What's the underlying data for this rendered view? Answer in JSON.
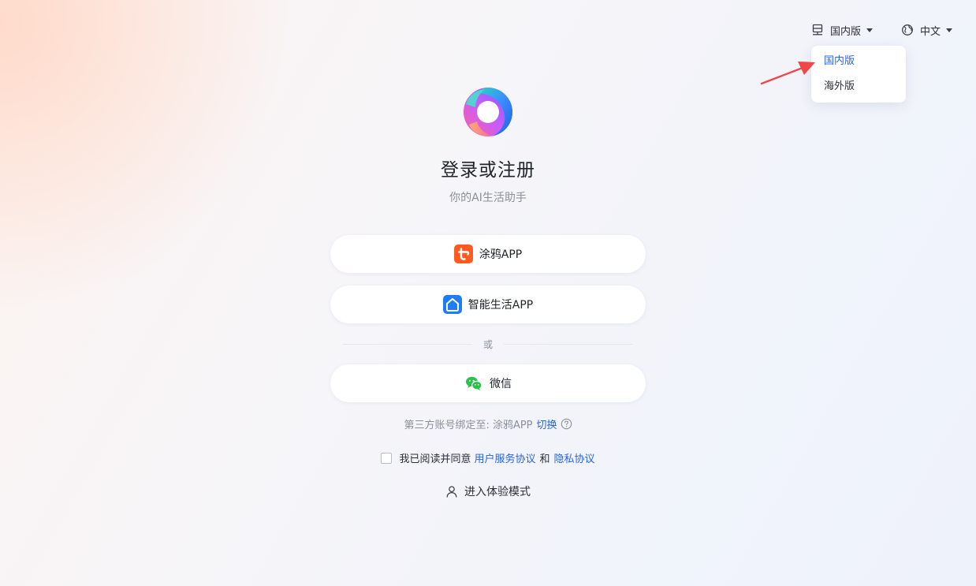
{
  "header": {
    "region_label": "国内版",
    "language_label": "中文"
  },
  "region_dropdown": {
    "options": [
      {
        "label": "国内版",
        "selected": true
      },
      {
        "label": "海外版",
        "selected": false
      }
    ]
  },
  "main": {
    "title": "登录或注册",
    "subtitle": "你的AI生活助手",
    "login_buttons": [
      {
        "label": "涂鸦APP",
        "icon": "tuya-app-icon"
      },
      {
        "label": "智能生活APP",
        "icon": "smart-life-app-icon"
      }
    ],
    "divider_text": "或",
    "wechat_button": {
      "label": "微信",
      "icon": "wechat-icon"
    },
    "bind_info": {
      "text": "第三方账号绑定至: 涂鸦APP",
      "switch_label": "切换"
    },
    "agreement": {
      "prefix": "我已阅读并同意",
      "terms_label": "用户服务协议",
      "and_text": "和",
      "privacy_label": "隐私协议",
      "checked": false
    },
    "trial_mode_label": "进入体验模式"
  },
  "colors": {
    "accent": "#2663e8",
    "tuya_orange": "#ff5a1f",
    "smart_life_blue": "#1f7cf5",
    "wechat_green": "#2bc24a",
    "annotation_red": "#f04848"
  }
}
